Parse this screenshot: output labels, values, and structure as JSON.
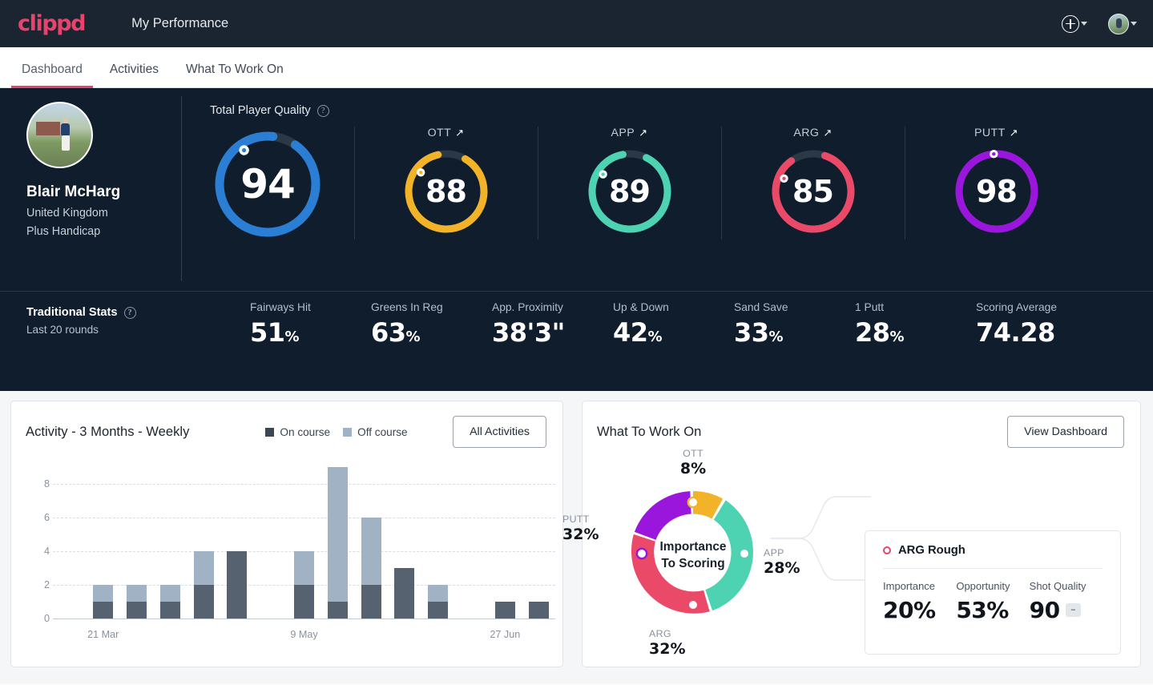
{
  "brand": {
    "logo_text": "clippd",
    "accent": "#e8436b"
  },
  "topbar": {
    "title": "My Performance",
    "add_icon": "plus-circle-icon",
    "add_caret_icon": "chevron-down-icon",
    "avatar_icon": "user-avatar-icon",
    "avatar_caret_icon": "chevron-down-icon"
  },
  "tabs": [
    {
      "label": "Dashboard",
      "active": true
    },
    {
      "label": "Activities",
      "active": false
    },
    {
      "label": "What To Work On",
      "active": false
    }
  ],
  "profile": {
    "name": "Blair McHarg",
    "country": "United Kingdom",
    "handicap": "Plus Handicap",
    "avatar_icon": "profile-photo"
  },
  "quality": {
    "heading": "Total Player Quality",
    "help_icon": "help-circle-icon",
    "total": {
      "label": "Total Player Quality",
      "value": "94",
      "value_num": 94,
      "color": "#2a7fd4",
      "marker_pct": 92
    },
    "skills": [
      {
        "label": "OTT",
        "value": "88",
        "value_num": 88,
        "color": "#f3b329",
        "marker_pct": 88,
        "trend_icon": "trend-up-icon",
        "trend": "↗"
      },
      {
        "label": "APP",
        "value": "89",
        "value_num": 89,
        "color": "#4ed3b2",
        "marker_pct": 89,
        "trend_icon": "trend-up-icon",
        "trend": "↗"
      },
      {
        "label": "ARG",
        "value": "85",
        "value_num": 85,
        "color": "#ea4a68",
        "marker_pct": 85,
        "trend_icon": "trend-up-icon",
        "trend": "↗"
      },
      {
        "label": "PUTT",
        "value": "98",
        "value_num": 98,
        "color": "#9b16dc",
        "marker_pct": 98,
        "trend_icon": "trend-up-icon",
        "trend": "↗"
      }
    ]
  },
  "traditional": {
    "title": "Traditional Stats",
    "help_icon": "help-circle-icon",
    "subtitle": "Last 20 rounds",
    "stats": [
      {
        "label": "Fairways Hit",
        "value": "51",
        "unit": "%"
      },
      {
        "label": "Greens In Reg",
        "value": "63",
        "unit": "%"
      },
      {
        "label": "App. Proximity",
        "value": "38'3\"",
        "unit": ""
      },
      {
        "label": "Up & Down",
        "value": "42",
        "unit": "%"
      },
      {
        "label": "Sand Save",
        "value": "33",
        "unit": "%"
      },
      {
        "label": "1 Putt",
        "value": "28",
        "unit": "%"
      },
      {
        "label": "Scoring Average",
        "value": "74.28",
        "unit": ""
      }
    ]
  },
  "activity": {
    "title": "Activity - 3 Months - Weekly",
    "legend": [
      {
        "label": "On course",
        "color": "#3c4652"
      },
      {
        "label": "Off course",
        "color": "#a0b2c4"
      }
    ],
    "button": "All Activities"
  },
  "chart_data": {
    "type": "bar",
    "title": "Activity - 3 Months - Weekly",
    "stacked": true,
    "xlabel": "",
    "ylabel": "",
    "ylim": [
      0,
      9
    ],
    "yticks": [
      0,
      2,
      4,
      6,
      8
    ],
    "grid": true,
    "legend_position": "top",
    "categories": [
      "w1",
      "w2",
      "w3",
      "w4",
      "w5",
      "w6",
      "w7",
      "w8",
      "w9",
      "w10",
      "w11",
      "w12",
      "w13",
      "w14",
      "w15"
    ],
    "tick_labels": [
      {
        "index": 1,
        "label": "21 Mar"
      },
      {
        "index": 7,
        "label": "9 May"
      },
      {
        "index": 13,
        "label": "27 Jun"
      }
    ],
    "series": [
      {
        "name": "On course",
        "color": "#56626f",
        "values": [
          0,
          1,
          1,
          1,
          2,
          4,
          0,
          2,
          1,
          2,
          3,
          1,
          0,
          1,
          1
        ]
      },
      {
        "name": "Off course",
        "color": "#a0b2c4",
        "values": [
          0,
          1,
          1,
          1,
          2,
          0,
          0,
          2,
          8,
          4,
          0,
          1,
          0,
          0,
          0
        ]
      }
    ]
  },
  "wtwo": {
    "title": "What To Work On",
    "button": "View Dashboard",
    "donut_center_line1": "Importance",
    "donut_center_line2": "To Scoring",
    "donut": {
      "type": "pie",
      "title": "Importance To Scoring",
      "segments": [
        {
          "name": "OTT",
          "label": "OTT",
          "percent": 8,
          "value": "8%",
          "color": "#f3b329"
        },
        {
          "name": "APP",
          "label": "APP",
          "percent": 28,
          "value": "28%",
          "color": "#4ed3b2"
        },
        {
          "name": "ARG",
          "label": "ARG",
          "percent": 32,
          "value": "32%",
          "color": "#ea4a68"
        },
        {
          "name": "PUTT",
          "label": "PUTT",
          "percent": 32,
          "value": "32%",
          "color": "#9b16dc"
        }
      ]
    },
    "detail": {
      "marker_icon": "circle-outline-icon",
      "title": "ARG Rough",
      "columns": [
        {
          "label": "Importance",
          "value": "20%"
        },
        {
          "label": "Opportunity",
          "value": "53%"
        },
        {
          "label": "Shot Quality",
          "value": "90",
          "chip": "–"
        }
      ]
    }
  }
}
